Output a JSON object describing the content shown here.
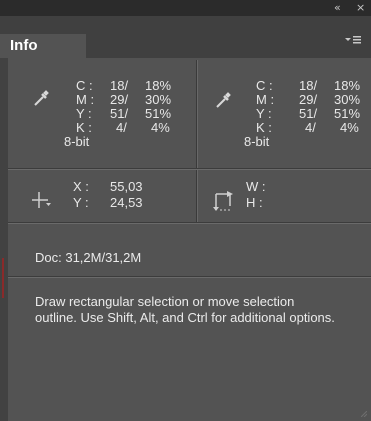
{
  "window": {
    "collapse_glyph": "«",
    "close_glyph": "×"
  },
  "panel": {
    "tab_label": "Info",
    "menu_icon": "panel-menu-icon"
  },
  "color_readout_1": {
    "icon": "eyedropper-icon",
    "rows": [
      {
        "label": "C :",
        "value": "18/",
        "percent": "18%"
      },
      {
        "label": "M :",
        "value": "29/",
        "percent": "30%"
      },
      {
        "label": "Y :",
        "value": "51/",
        "percent": "51%"
      },
      {
        "label": "K :",
        "value": "4/",
        "percent": "4%"
      }
    ],
    "bit_depth": "8-bit"
  },
  "color_readout_2": {
    "icon": "eyedropper-icon",
    "rows": [
      {
        "label": "C :",
        "value": "18/",
        "percent": "18%"
      },
      {
        "label": "M :",
        "value": "29/",
        "percent": "30%"
      },
      {
        "label": "Y :",
        "value": "51/",
        "percent": "51%"
      },
      {
        "label": "K :",
        "value": "4/",
        "percent": "4%"
      }
    ],
    "bit_depth": "8-bit"
  },
  "position": {
    "icon": "crosshair-icon",
    "x_label": "X :",
    "x_value": "55,03",
    "y_label": "Y :",
    "y_value": "24,53"
  },
  "dimensions": {
    "icon": "selection-size-icon",
    "w_label": "W :",
    "w_value": "",
    "h_label": "H :",
    "h_value": ""
  },
  "document": {
    "size_text": "Doc: 31,2M/31,2M"
  },
  "tool_hint": {
    "text": "Draw rectangular selection or move selection outline.  Use Shift, Alt, and Ctrl for additional options."
  },
  "colors": {
    "panel_bg": "#535353",
    "tab_bar_bg": "#404040",
    "title_bar_bg": "#2b2b2b",
    "text": "#e8e8e8"
  }
}
